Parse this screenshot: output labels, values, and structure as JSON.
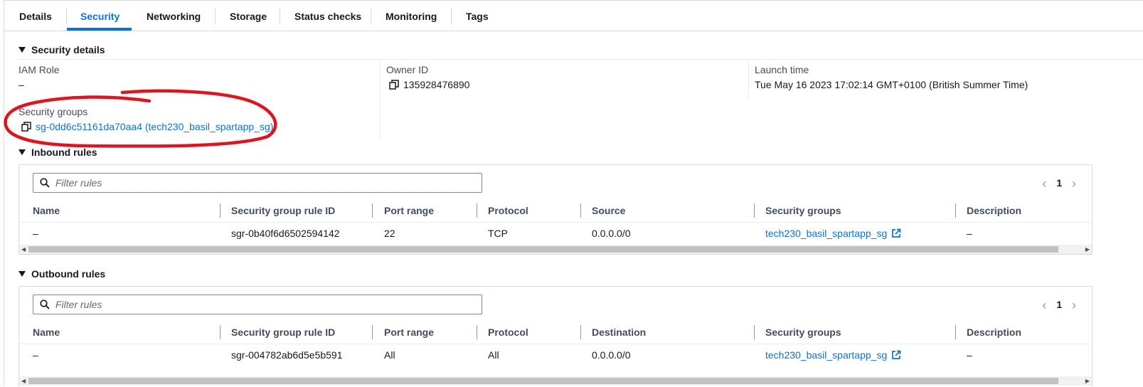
{
  "tabs": [
    {
      "label": "Details"
    },
    {
      "label": "Security"
    },
    {
      "label": "Networking"
    },
    {
      "label": "Storage"
    },
    {
      "label": "Status checks"
    },
    {
      "label": "Monitoring"
    },
    {
      "label": "Tags"
    }
  ],
  "active_tab": "Security",
  "security_details": {
    "header": "Security details",
    "iam_role_label": "IAM Role",
    "iam_role_value": "–",
    "owner_id_label": "Owner ID",
    "owner_id_value": "135928476890",
    "launch_time_label": "Launch time",
    "launch_time_value": "Tue May 16 2023 17:02:14 GMT+0100 (British Summer Time)",
    "security_groups_label": "Security groups",
    "security_groups_value": "sg-0dd6c51161da70aa4 (tech230_basil_spartapp_sg)"
  },
  "inbound": {
    "header": "Inbound rules",
    "filter_placeholder": "Filter rules",
    "page": "1",
    "columns": [
      "Name",
      "Security group rule ID",
      "Port range",
      "Protocol",
      "Source",
      "Security groups",
      "Description"
    ],
    "rows": [
      [
        "–",
        "sgr-0b40f6d6502594142",
        "22",
        "TCP",
        "0.0.0.0/0",
        "tech230_basil_spartapp_sg",
        "–"
      ]
    ]
  },
  "outbound": {
    "header": "Outbound rules",
    "filter_placeholder": "Filter rules",
    "page": "1",
    "columns": [
      "Name",
      "Security group rule ID",
      "Port range",
      "Protocol",
      "Destination",
      "Security groups",
      "Description"
    ],
    "rows": [
      [
        "–",
        "sgr-004782ab6d5e5b591",
        "All",
        "All",
        "0.0.0.0/0",
        "tech230_basil_spartapp_sg",
        "–"
      ]
    ]
  },
  "colors": {
    "accent": "#0972d3",
    "annotation": "#e0141e"
  }
}
